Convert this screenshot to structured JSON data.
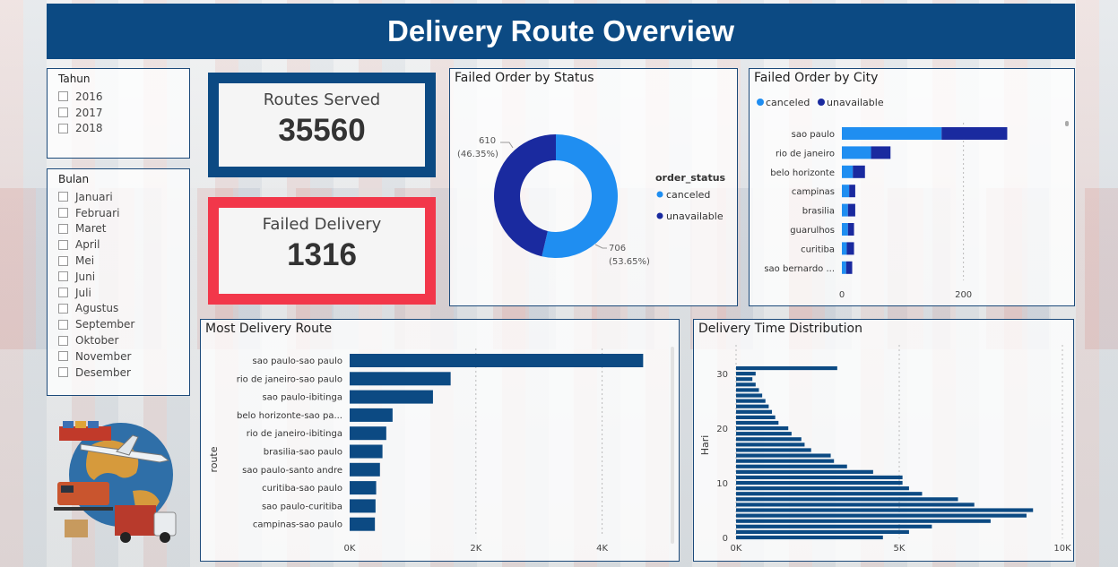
{
  "header": {
    "title": "Delivery Route Overview"
  },
  "slicer_tahun": {
    "title": "Tahun",
    "items": [
      "2016",
      "2017",
      "2018"
    ]
  },
  "slicer_bulan": {
    "title": "Bulan",
    "items": [
      "Januari",
      "Februari",
      "Maret",
      "April",
      "Mei",
      "Juni",
      "Juli",
      "Agustus",
      "September",
      "Oktober",
      "November",
      "Desember"
    ]
  },
  "kpi": {
    "routes_label": "Routes Served",
    "routes_value": "35560",
    "failed_label": "Failed Delivery",
    "failed_value": "1316"
  },
  "colors": {
    "brand": "#0c4a83",
    "canceled": "#1f8ef1",
    "unavailable": "#1a2a9f",
    "bar": "#0c4a83",
    "kpi_red": "#f2374a"
  },
  "chart_data": [
    {
      "id": "status",
      "type": "pie",
      "title": "Failed Order by Status",
      "legend_title": "order_status",
      "legend_position": "right",
      "series": [
        {
          "name": "canceled",
          "value": 706,
          "label": "706",
          "pct": "(53.65%)"
        },
        {
          "name": "unavailable",
          "value": 610,
          "label": "610",
          "pct": "(46.35%)"
        }
      ]
    },
    {
      "id": "city",
      "type": "bar",
      "title": "Failed Order by City",
      "legend_position": "top-left",
      "categories": [
        "sao paulo",
        "rio de janeiro",
        "belo horizonte",
        "campinas",
        "brasilia",
        "guarulhos",
        "curitiba",
        "sao bernardo ..."
      ],
      "series": [
        {
          "name": "canceled",
          "values": [
            164,
            48,
            18,
            12,
            10,
            10,
            8,
            7
          ]
        },
        {
          "name": "unavailable",
          "values": [
            108,
            32,
            20,
            10,
            12,
            10,
            12,
            10
          ]
        }
      ],
      "xticks": [
        "0",
        "200"
      ],
      "xlim": [
        0,
        320
      ]
    },
    {
      "id": "routes",
      "type": "bar",
      "title": "Most Delivery Route",
      "ylabel": "route",
      "categories": [
        "sao paulo-sao paulo",
        "rio de janeiro-sao paulo",
        "sao paulo-ibitinga",
        "belo horizonte-sao pa...",
        "rio de janeiro-ibitinga",
        "brasilia-sao paulo",
        "sao paulo-santo andre",
        "curitiba-sao paulo",
        "sao paulo-curitiba",
        "campinas-sao paulo"
      ],
      "values": [
        4650,
        1600,
        1320,
        680,
        580,
        520,
        480,
        420,
        410,
        400
      ],
      "xticks": [
        "0K",
        "2K",
        "4K"
      ],
      "xlim": [
        0,
        5000
      ]
    },
    {
      "id": "time",
      "type": "bar",
      "title": "Delivery Time Distribution",
      "ylabel": "Hari",
      "x_ticks": [
        "0K",
        "5K",
        "10K"
      ],
      "y_ticks": [
        "0",
        "10",
        "20",
        "30"
      ],
      "xlim": [
        0,
        10000
      ],
      "days": [
        0,
        1,
        2,
        3,
        4,
        5,
        6,
        7,
        8,
        9,
        10,
        11,
        12,
        13,
        14,
        15,
        16,
        17,
        18,
        19,
        20,
        21,
        22,
        23,
        24,
        25,
        26,
        27,
        28,
        29,
        30,
        31
      ],
      "values": [
        4500,
        5300,
        6000,
        7800,
        8900,
        9100,
        7300,
        6800,
        5700,
        5300,
        5100,
        5100,
        4200,
        3400,
        3000,
        2900,
        2300,
        2100,
        2000,
        1700,
        1600,
        1300,
        1200,
        1100,
        1000,
        900,
        800,
        700,
        600,
        500,
        600,
        3100
      ]
    }
  ]
}
